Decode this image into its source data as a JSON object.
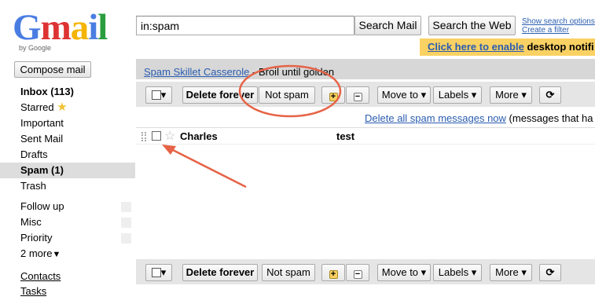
{
  "logo": {
    "text": "Gmail",
    "byline": "by Google"
  },
  "search": {
    "value": "in:spam",
    "search_mail": "Search Mail",
    "search_web": "Search the Web"
  },
  "toplinks": {
    "options": "Show search options",
    "filter": "Create a filter"
  },
  "promo": {
    "link": "Click here to enable",
    "tail": "desktop notifi"
  },
  "compose": "Compose mail",
  "nav": {
    "inbox": "Inbox (113)",
    "starred": "Starred",
    "important": "Important",
    "sent": "Sent Mail",
    "drafts": "Drafts",
    "spam": "Spam (1)",
    "trash": "Trash",
    "followup": "Follow up",
    "misc": "Misc",
    "priority": "Priority",
    "more": "2 more",
    "contacts": "Contacts",
    "tasks": "Tasks"
  },
  "webclip": {
    "source": "Spam Skillet Casserole",
    "tail": "- Broil until golden"
  },
  "toolbar": {
    "delete_forever": "Delete forever",
    "not_spam": "Not spam",
    "move_to": "Move to",
    "labels": "Labels",
    "more": "More",
    "refresh": "⟳"
  },
  "spam_note": {
    "link": "Delete all spam messages now",
    "tail": "(messages that ha"
  },
  "messages": [
    {
      "sender": "Charles",
      "subject": "test"
    }
  ],
  "colors": {
    "accent": "#2a5db0",
    "annotation": "#e66347",
    "promo": "#fad163"
  },
  "icons": {
    "dropdown": "▾",
    "star": "☆",
    "star_filled": "★"
  }
}
